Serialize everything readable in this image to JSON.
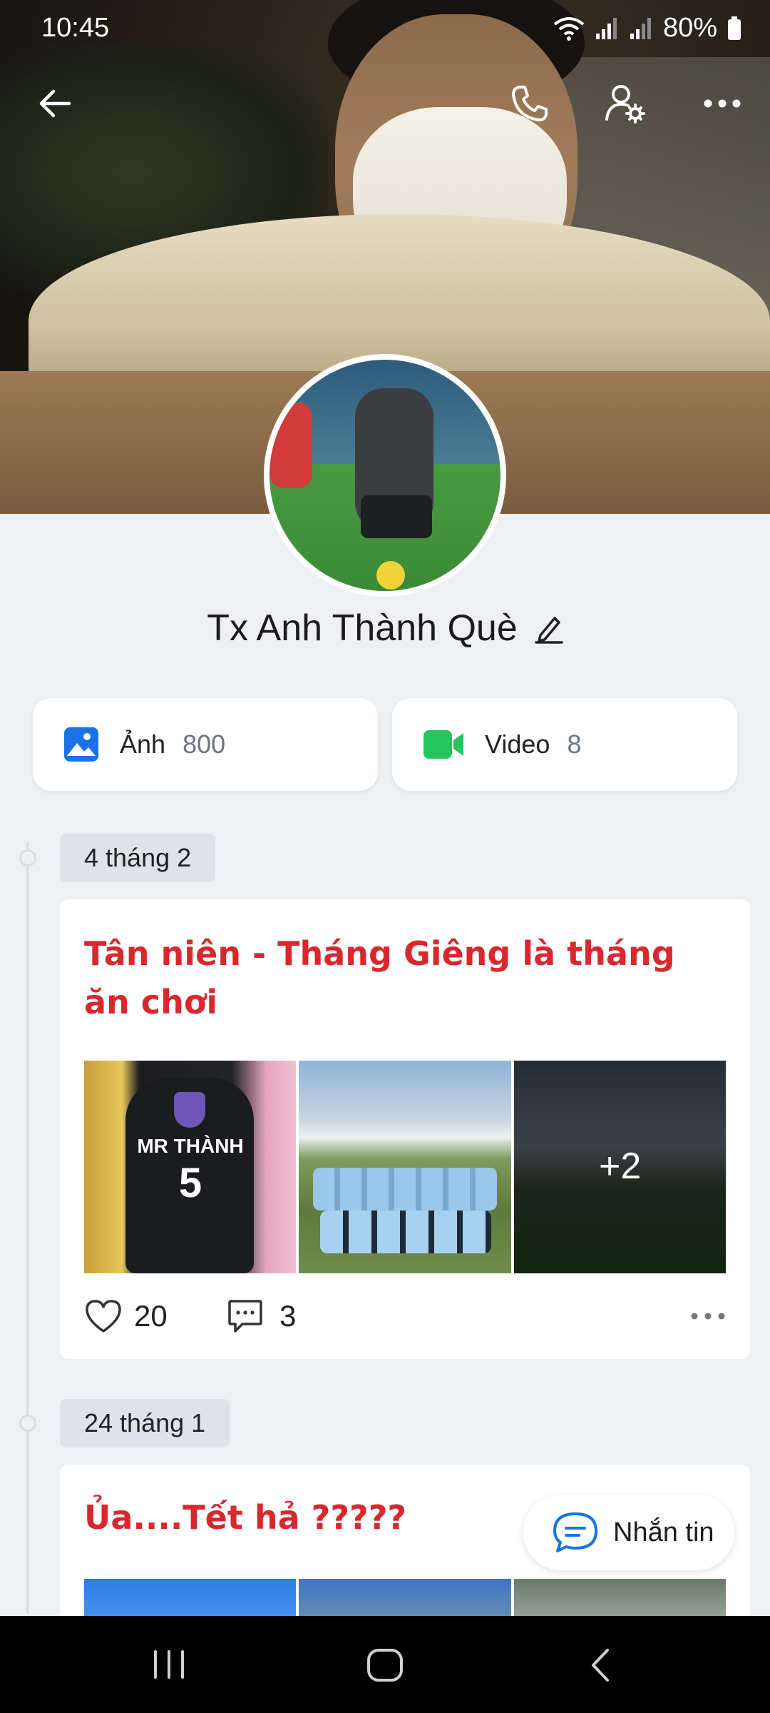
{
  "status_bar": {
    "time": "10:45",
    "battery": "80%"
  },
  "header": {
    "back_icon": "arrow-left-icon",
    "call_icon": "phone-icon",
    "settings_icon": "user-gear-icon",
    "more_icon": "more-horizontal-icon"
  },
  "profile": {
    "name": "Tx Anh Thành Què"
  },
  "media": {
    "photos": {
      "label": "Ảnh",
      "count": "800"
    },
    "videos": {
      "label": "Video",
      "count": "8"
    }
  },
  "posts": [
    {
      "date": "4 tháng 2",
      "title": "Tân niên - Tháng Giêng là tháng ăn chơi",
      "more_count": "+2",
      "likes": "20",
      "comments": "3",
      "bag_text_line1": "MR THÀNH",
      "bag_text_line2": "5"
    },
    {
      "date": "24 tháng 1",
      "title": "Ủa....Tết hả ?????"
    }
  ],
  "fab": {
    "label": "Nhắn tin"
  },
  "colors": {
    "accent": "#0068ff",
    "title_red": "#d8282e",
    "video_green": "#22c55e"
  }
}
